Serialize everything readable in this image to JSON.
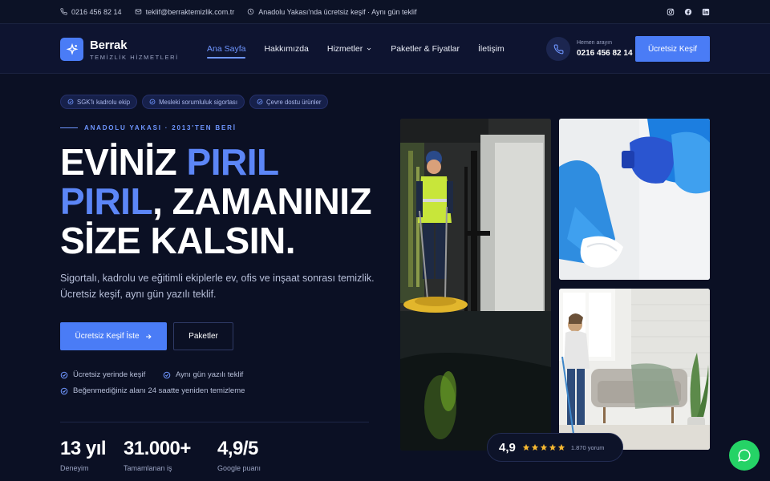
{
  "topbar": {
    "phone": "0216 456 82 14",
    "email": "teklif@berraktemizlik.com.tr",
    "hours": "Anadolu Yakası'nda ücretsiz keşif · Aynı gün teklif"
  },
  "brand": {
    "name": "Berrak",
    "tagline": "TEMİZLİK HİZMETLERİ",
    "accent": "#4a7cf6"
  },
  "nav": {
    "items": [
      {
        "label": "Ana Sayfa"
      },
      {
        "label": "Hakkımızda"
      },
      {
        "label": "Hizmetler"
      },
      {
        "label": "Paketler & Fiyatlar"
      },
      {
        "label": "İletişim"
      }
    ],
    "phone_caption": "Hemen arayın",
    "phone_number": "0216 456 82 14",
    "cta_label": "Ücretsiz Keşif"
  },
  "hero": {
    "badges": [
      {
        "label": "SGK'lı kadrolu ekip"
      },
      {
        "label": "Mesleki sorumluluk sigortası"
      },
      {
        "label": "Çevre dostu ürünler"
      }
    ],
    "eyebrow": "ANADOLU YAKASI · 2013'TEN BERİ",
    "headline_1": "EVİNİZ ",
    "headline_hl": "PIRIL PIRIL",
    "headline_2": ", ZAMANINIZ SİZE KALSIN.",
    "subtext": "Sigortalı, kadrolu ve eğitimli ekiplerle ev, ofis ve inşaat sonrası temizlik. Ücretsiz keşif, aynı gün yazılı teklif.",
    "primary_button": "Ücretsiz Keşif İste",
    "secondary_button": "Paketler",
    "checks": [
      {
        "label": "Ücretsiz yerinde keşif"
      },
      {
        "label": "Aynı gün yazılı teklif"
      },
      {
        "label": "Beğenmediğiniz alanı 24 saatte yeniden temizleme"
      }
    ],
    "stats": [
      {
        "value": "13 yıl",
        "label": "Deneyim"
      },
      {
        "value": "31.000+",
        "label": "Tamamlanan iş"
      },
      {
        "value": "4,9/5",
        "label": "Google puanı"
      }
    ]
  },
  "rating": {
    "value": "4,9",
    "stars": 5,
    "count": "1.870 yorum"
  }
}
